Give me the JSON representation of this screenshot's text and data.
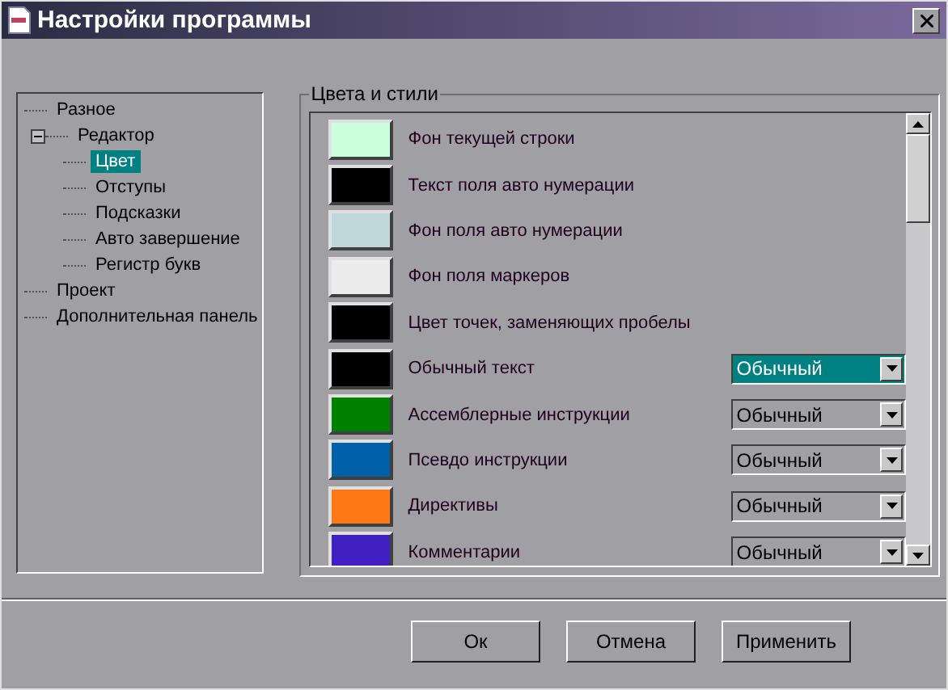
{
  "window": {
    "title": "Настройки программы"
  },
  "tree": [
    {
      "label": "Разное",
      "selected": false
    },
    {
      "label": "Редактор",
      "selected": false,
      "expanded": true,
      "children": [
        {
          "label": "Цвет",
          "selected": true
        },
        {
          "label": "Отступы",
          "selected": false
        },
        {
          "label": "Подсказки",
          "selected": false
        },
        {
          "label": "Авто завершение",
          "selected": false
        },
        {
          "label": "Регистр букв",
          "selected": false
        }
      ]
    },
    {
      "label": "Проект",
      "selected": false
    },
    {
      "label": "Дополнительная панель",
      "selected": false
    }
  ],
  "group": {
    "title": "Цвета и стили",
    "items": [
      {
        "kind": "color",
        "label": "Фон текущей строки",
        "color": "#ccffdd"
      },
      {
        "kind": "color",
        "label": "Текст поля авто нумерации",
        "color": "#000000"
      },
      {
        "kind": "color",
        "label": "Фон поля авто нумерации",
        "color": "#c0d8dc"
      },
      {
        "kind": "color",
        "label": "Фон поля маркеров",
        "color": "#ececec"
      },
      {
        "kind": "color",
        "label": "Цвет точек, заменяющих пробелы",
        "color": "#000000"
      },
      {
        "kind": "styled",
        "label": "Обычный текст",
        "color": "#000000",
        "style": "Обычный",
        "selected": true
      },
      {
        "kind": "styled",
        "label": "Ассемблерные инструкции",
        "color": "#008000",
        "style": "Обычный",
        "selected": false
      },
      {
        "kind": "styled",
        "label": "Псевдо инструкции",
        "color": "#0060a8",
        "style": "Обычный",
        "selected": false
      },
      {
        "kind": "styled",
        "label": "Директивы",
        "color": "#ff7818",
        "style": "Обычный",
        "selected": false
      },
      {
        "kind": "styled",
        "label": "Комментарии",
        "color": "#4020c0",
        "style": "Обычный",
        "selected": false
      }
    ]
  },
  "buttons": [
    "Ок",
    "Отмена",
    "Применить"
  ]
}
